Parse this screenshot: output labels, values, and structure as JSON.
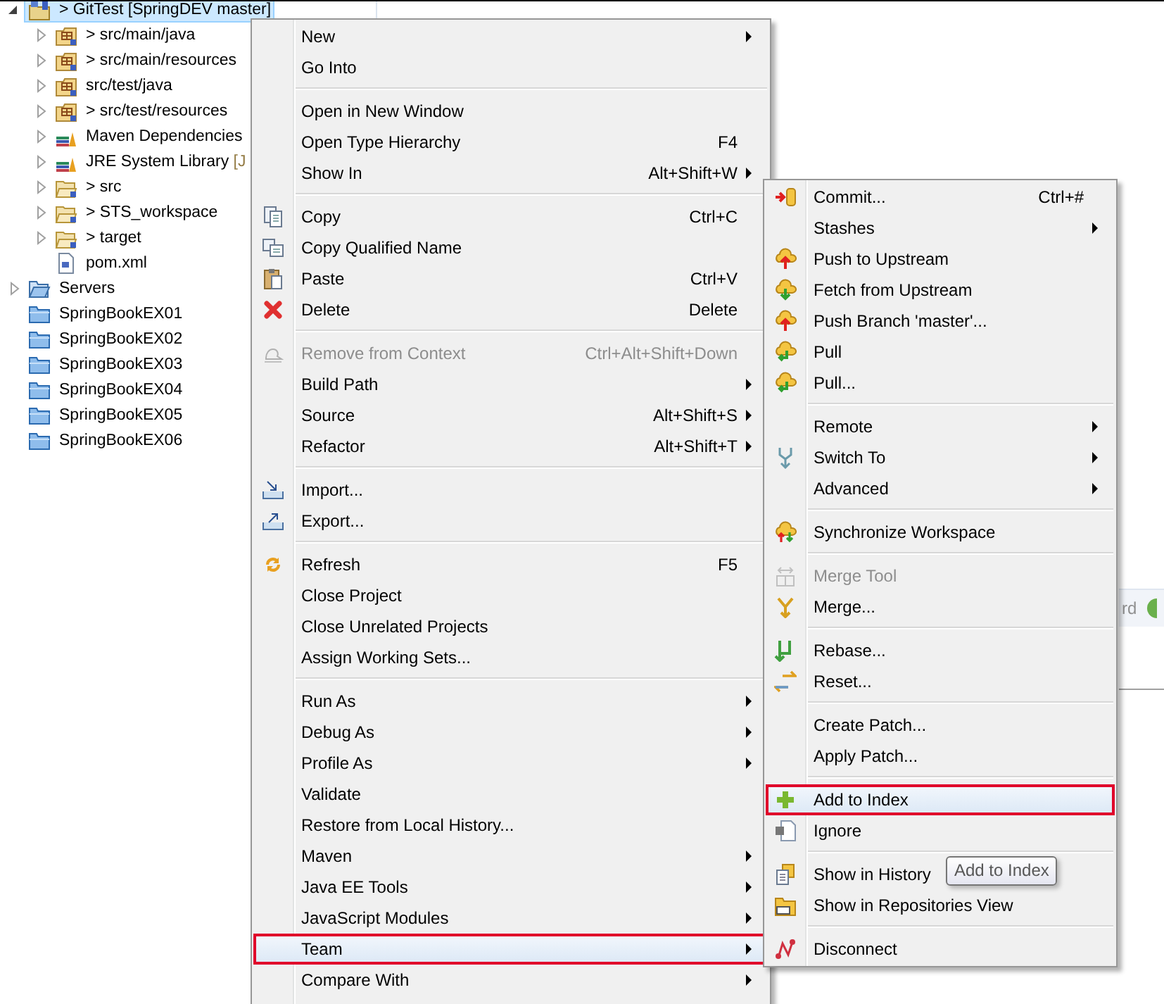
{
  "tree": {
    "items": [
      {
        "kind": "project",
        "label": "> GitTest [SpringDEV master]",
        "expanded": true,
        "selected": true,
        "children": [
          {
            "kind": "package-folder",
            "label": "> src/main/java",
            "expanded": false,
            "selected": false
          },
          {
            "kind": "package-folder",
            "label": "> src/main/resources",
            "expanded": false,
            "selected": false
          },
          {
            "kind": "package-folder",
            "label": "src/test/java",
            "expanded": false,
            "selected": false
          },
          {
            "kind": "package-folder",
            "label": "> src/test/resources",
            "expanded": false,
            "selected": false
          },
          {
            "kind": "library",
            "label": "Maven Dependencies",
            "expanded": false,
            "selected": false
          },
          {
            "kind": "library",
            "label": "JRE System Library",
            "decoration": "[J",
            "expanded": false,
            "selected": false
          },
          {
            "kind": "folder",
            "label": "> src",
            "expanded": false,
            "selected": false
          },
          {
            "kind": "folder",
            "label": "> STS_workspace",
            "expanded": false,
            "selected": false
          },
          {
            "kind": "folder",
            "label": "> target",
            "expanded": false,
            "selected": false
          },
          {
            "kind": "file",
            "label": "pom.xml",
            "selected": false
          }
        ]
      },
      {
        "kind": "open-folder",
        "label": "Servers",
        "expanded": false,
        "selected": false
      },
      {
        "kind": "closed-project",
        "label": "SpringBookEX01",
        "selected": false
      },
      {
        "kind": "closed-project",
        "label": "SpringBookEX02",
        "selected": false
      },
      {
        "kind": "closed-project",
        "label": "SpringBookEX03",
        "selected": false
      },
      {
        "kind": "closed-project",
        "label": "SpringBookEX04",
        "selected": false
      },
      {
        "kind": "closed-project",
        "label": "SpringBookEX05",
        "selected": false
      },
      {
        "kind": "closed-project",
        "label": "SpringBookEX06",
        "selected": false
      }
    ]
  },
  "background_view": {
    "text": "rd"
  },
  "context_menu": {
    "items": [
      {
        "kind": "item",
        "label": "New",
        "submenu": true,
        "disabled": false,
        "selected": false
      },
      {
        "kind": "item",
        "label": "Go Into",
        "submenu": false,
        "disabled": false,
        "selected": false
      },
      {
        "kind": "separator"
      },
      {
        "kind": "item",
        "label": "Open in New Window",
        "submenu": false,
        "disabled": false,
        "selected": false
      },
      {
        "kind": "item",
        "label": "Open Type Hierarchy",
        "shortcut": "F4",
        "submenu": false,
        "disabled": false,
        "selected": false
      },
      {
        "kind": "item",
        "label": "Show In",
        "shortcut": "Alt+Shift+W",
        "submenu": true,
        "disabled": false,
        "selected": false
      },
      {
        "kind": "separator"
      },
      {
        "kind": "copy",
        "label": "Copy",
        "shortcut": "Ctrl+C",
        "submenu": false,
        "disabled": false,
        "selected": false
      },
      {
        "kind": "copy-name",
        "label": "Copy Qualified Name",
        "submenu": false,
        "disabled": false,
        "selected": false
      },
      {
        "kind": "paste",
        "label": "Paste",
        "shortcut": "Ctrl+V",
        "submenu": false,
        "disabled": false,
        "selected": false
      },
      {
        "kind": "delete",
        "label": "Delete",
        "shortcut": "Delete",
        "submenu": false,
        "disabled": false,
        "selected": false
      },
      {
        "kind": "separator"
      },
      {
        "kind": "remove",
        "label": "Remove from Context",
        "shortcut": "Ctrl+Alt+Shift+Down",
        "submenu": false,
        "disabled": true,
        "selected": false
      },
      {
        "kind": "item",
        "label": "Build Path",
        "submenu": true,
        "disabled": false,
        "selected": false
      },
      {
        "kind": "item",
        "label": "Source",
        "shortcut": "Alt+Shift+S",
        "submenu": true,
        "disabled": false,
        "selected": false
      },
      {
        "kind": "item",
        "label": "Refactor",
        "shortcut": "Alt+Shift+T",
        "submenu": true,
        "disabled": false,
        "selected": false
      },
      {
        "kind": "separator"
      },
      {
        "kind": "import",
        "label": "Import...",
        "submenu": false,
        "disabled": false,
        "selected": false
      },
      {
        "kind": "export",
        "label": "Export...",
        "submenu": false,
        "disabled": false,
        "selected": false
      },
      {
        "kind": "separator"
      },
      {
        "kind": "refresh",
        "label": "Refresh",
        "shortcut": "F5",
        "submenu": false,
        "disabled": false,
        "selected": false
      },
      {
        "kind": "item",
        "label": "Close Project",
        "submenu": false,
        "disabled": false,
        "selected": false
      },
      {
        "kind": "item",
        "label": "Close Unrelated Projects",
        "submenu": false,
        "disabled": false,
        "selected": false
      },
      {
        "kind": "item",
        "label": "Assign Working Sets...",
        "submenu": false,
        "disabled": false,
        "selected": false
      },
      {
        "kind": "separator"
      },
      {
        "kind": "item",
        "label": "Run As",
        "submenu": true,
        "disabled": false,
        "selected": false
      },
      {
        "kind": "item",
        "label": "Debug As",
        "submenu": true,
        "disabled": false,
        "selected": false
      },
      {
        "kind": "item",
        "label": "Profile As",
        "submenu": true,
        "disabled": false,
        "selected": false
      },
      {
        "kind": "item",
        "label": "Validate",
        "submenu": false,
        "disabled": false,
        "selected": false
      },
      {
        "kind": "item",
        "label": "Restore from Local History...",
        "submenu": false,
        "disabled": false,
        "selected": false
      },
      {
        "kind": "item",
        "label": "Maven",
        "submenu": true,
        "disabled": false,
        "selected": false
      },
      {
        "kind": "item",
        "label": "Java EE Tools",
        "submenu": true,
        "disabled": false,
        "selected": false
      },
      {
        "kind": "item",
        "label": "JavaScript Modules",
        "submenu": true,
        "disabled": false,
        "selected": false
      },
      {
        "kind": "item",
        "label": "Team",
        "submenu": true,
        "disabled": false,
        "selected": true
      },
      {
        "kind": "item",
        "label": "Compare With",
        "submenu": true,
        "disabled": false,
        "selected": false
      }
    ]
  },
  "team_submenu": {
    "items": [
      {
        "kind": "commit",
        "label": "Commit...",
        "shortcut": "Ctrl+#",
        "submenu": false,
        "disabled": false,
        "selected": false
      },
      {
        "kind": "item",
        "label": "Stashes",
        "submenu": true,
        "disabled": false,
        "selected": false
      },
      {
        "kind": "push",
        "label": "Push to Upstream",
        "submenu": false,
        "disabled": false,
        "selected": false
      },
      {
        "kind": "fetch",
        "label": "Fetch from Upstream",
        "submenu": false,
        "disabled": false,
        "selected": false
      },
      {
        "kind": "push",
        "label": "Push Branch 'master'...",
        "submenu": false,
        "disabled": false,
        "selected": false
      },
      {
        "kind": "pull",
        "label": "Pull",
        "submenu": false,
        "disabled": false,
        "selected": false
      },
      {
        "kind": "pull",
        "label": "Pull...",
        "submenu": false,
        "disabled": false,
        "selected": false
      },
      {
        "kind": "separator"
      },
      {
        "kind": "item",
        "label": "Remote",
        "submenu": true,
        "disabled": false,
        "selected": false
      },
      {
        "kind": "switch",
        "label": "Switch To",
        "submenu": true,
        "disabled": false,
        "selected": false
      },
      {
        "kind": "item",
        "label": "Advanced",
        "submenu": true,
        "disabled": false,
        "selected": false
      },
      {
        "kind": "separator"
      },
      {
        "kind": "sync",
        "label": "Synchronize Workspace",
        "submenu": false,
        "disabled": false,
        "selected": false
      },
      {
        "kind": "separator"
      },
      {
        "kind": "merge-tool",
        "label": "Merge Tool",
        "submenu": false,
        "disabled": true,
        "selected": false
      },
      {
        "kind": "merge",
        "label": "Merge...",
        "submenu": false,
        "disabled": false,
        "selected": false
      },
      {
        "kind": "separator"
      },
      {
        "kind": "rebase",
        "label": "Rebase...",
        "submenu": false,
        "disabled": false,
        "selected": false
      },
      {
        "kind": "reset",
        "label": "Reset...",
        "submenu": false,
        "disabled": false,
        "selected": false
      },
      {
        "kind": "separator"
      },
      {
        "kind": "item",
        "label": "Create Patch...",
        "submenu": false,
        "disabled": false,
        "selected": false
      },
      {
        "kind": "item",
        "label": "Apply Patch...",
        "submenu": false,
        "disabled": false,
        "selected": false
      },
      {
        "kind": "separator"
      },
      {
        "kind": "add",
        "label": "Add to Index",
        "submenu": false,
        "disabled": false,
        "selected": true
      },
      {
        "kind": "ignore",
        "label": "Ignore",
        "submenu": false,
        "disabled": false,
        "selected": false
      },
      {
        "kind": "separator"
      },
      {
        "kind": "history",
        "label": "Show in History",
        "submenu": false,
        "disabled": false,
        "selected": false
      },
      {
        "kind": "repository",
        "label": "Show in Repositories View",
        "submenu": false,
        "disabled": false,
        "selected": false
      },
      {
        "kind": "separator"
      },
      {
        "kind": "disconnect",
        "label": "Disconnect",
        "submenu": false,
        "disabled": false,
        "selected": false
      }
    ]
  },
  "tooltip": {
    "text": "Add to Index"
  }
}
